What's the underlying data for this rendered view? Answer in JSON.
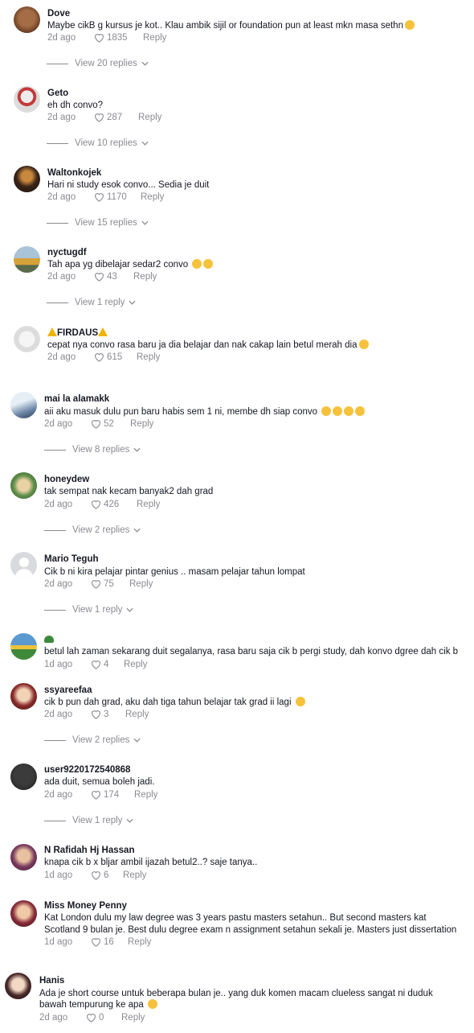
{
  "reply_label": "Reply",
  "comments": [
    {
      "username": "Dove",
      "text": "Maybe cikB g kursus je kot.. Klau ambik sijil or foundation pun at least mkn masa sethn",
      "text2": "",
      "emoji": "grin-sweat-emoji",
      "time": "2d ago",
      "likes": "1835",
      "replies": "View 20 replies"
    },
    {
      "username": "Geto",
      "text": "eh dh convo?",
      "text2": "",
      "time": "2d ago",
      "likes": "287",
      "replies": "View 10 replies"
    },
    {
      "username": "Waltonkojek",
      "text": "Hari ni study esok convo... Sedia je duit",
      "text2": "",
      "time": "2d ago",
      "likes": "1170",
      "replies": "View 15 replies"
    },
    {
      "username": "nyctugdf",
      "text": "Tah apa yg dibelajar sedar2 convo",
      "text2": "",
      "emoji": "woozy-emoji-x2",
      "time": "2d ago",
      "likes": "43",
      "replies": "View 1 reply"
    },
    {
      "username": "FIRDAUS",
      "text": "cepat nya convo rasa baru ja dia belajar dan nak cakap lain betul merah dia",
      "text2": "",
      "emoji": "grin-sweat-emoji",
      "time": "2d ago",
      "likes": "615",
      "replies": ""
    },
    {
      "username": "mai la alamakk",
      "text": "aii aku masuk dulu pun baru habis sem 1 ni, membe dh siap convo",
      "text2": "",
      "emoji": "disappointed-emoji-x4",
      "time": "2d ago",
      "likes": "52",
      "replies": "View 8 replies"
    },
    {
      "username": "honeydew",
      "text": "tak sempat nak kecam banyak2 dah grad",
      "text2": "",
      "time": "2d ago",
      "likes": "426",
      "replies": "View 2 replies"
    },
    {
      "username": "Mario Teguh",
      "text": "Cik b ni kira pelajar pintar genius .. masam pelajar tahun lompat",
      "text2": "",
      "time": "2d ago",
      "likes": "75",
      "replies": "View 1 reply"
    },
    {
      "username": "",
      "text": "betul lah zaman sekarang duit segalanya, rasa baru saja cik b pergi study, dah konvo dgree dah cik b",
      "text2": "",
      "emoji": "turtle-emoji",
      "time": "1d ago",
      "likes": "4",
      "replies": ""
    },
    {
      "username": "ssyareefaa",
      "text": "cik b pun dah grad, aku dah tiga tahun belajar tak grad ii lagi",
      "text2": "",
      "emoji": "disappointed-emoji",
      "time": "2d ago",
      "likes": "3",
      "replies": "View 2 replies"
    },
    {
      "username": "user9220172540868",
      "text": "ada duit, semua boleh jadi.",
      "text2": "",
      "time": "2d ago",
      "likes": "174",
      "replies": "View 1 reply"
    },
    {
      "username": "N Rafidah Hj Hassan",
      "text": "knapa cik b x bljar ambil ijazah betul2..? saje tanya..",
      "text2": "",
      "time": "1d ago",
      "likes": "6",
      "replies": ""
    },
    {
      "username": "Miss Money Penny",
      "text": "Kat London dulu my law degree was 3 years pastu masters setahun.. But second masters kat",
      "text2": "Scotland 9 bulan je. Best dulu degree exam n assignment setahun sekali je. Masters just dissertation",
      "time": "1d ago",
      "likes": "16",
      "replies": ""
    },
    {
      "username": "Hanis",
      "text": "Ada je short course untuk beberapa bulan je.. yang duk komen macam clueless sangat ni duduk",
      "text2": "bawah tempurung ke apa",
      "emoji": "upside-down-emoji",
      "time": "2d ago",
      "likes": "0",
      "replies": ""
    }
  ]
}
